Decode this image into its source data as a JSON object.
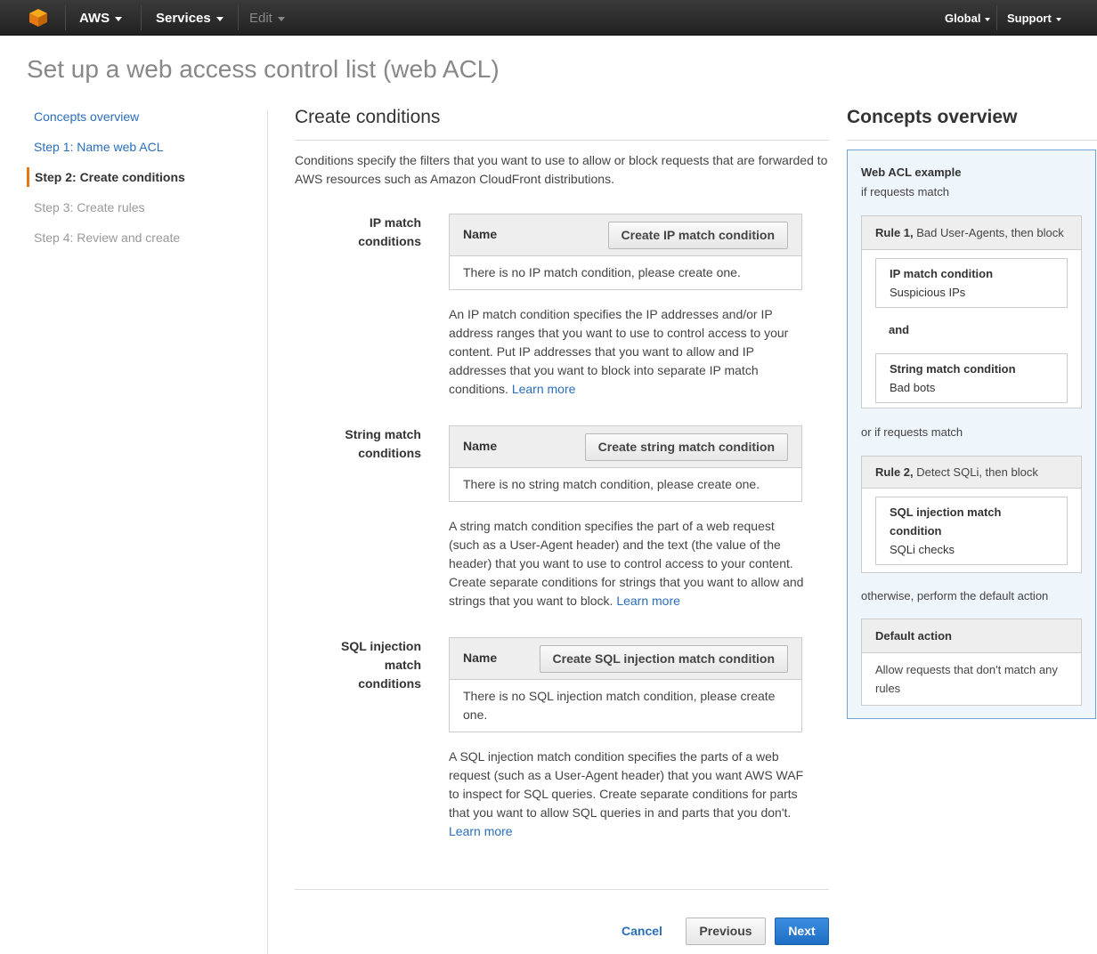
{
  "nav": {
    "brand": "AWS",
    "services": "Services",
    "edit": "Edit",
    "region": "Global",
    "support": "Support"
  },
  "page_title": "Set up a web access control list (web ACL)",
  "steps": [
    {
      "label": "Concepts overview"
    },
    {
      "label": "Step 1: Name web ACL"
    },
    {
      "label": "Step 2: Create conditions"
    },
    {
      "label": "Step 3: Create rules"
    },
    {
      "label": "Step 4: Review and create"
    }
  ],
  "main": {
    "heading": "Create conditions",
    "intro": "Conditions specify the filters that you want to use to allow or block requests that are forwarded to AWS resources such as Amazon CloudFront distributions.",
    "conditions": [
      {
        "label_l1": "IP match",
        "label_l2": "conditions",
        "column": "Name",
        "button": "Create IP match condition",
        "empty": "There is no IP match condition, please create one.",
        "desc": "An IP match condition specifies the IP addresses and/or IP address ranges that you want to use to control access to your content. Put IP addresses that you want to allow and IP addresses that you want to block into separate IP match conditions.",
        "learn": "Learn more"
      },
      {
        "label_l1": "String match",
        "label_l2": "conditions",
        "column": "Name",
        "button": "Create string match condition",
        "empty": "There is no string match condition, please create one.",
        "desc": "A string match condition specifies the part of a web request (such as a User-Agent header) and the text (the value of the header) that you want to use to control access to your content. Create separate conditions for strings that you want to allow and strings that you want to block.",
        "learn": "Learn more"
      },
      {
        "label_l1": "SQL injection",
        "label_l2": "match",
        "label_l3": "conditions",
        "column": "Name",
        "button": "Create SQL injection match condition",
        "empty": "There is no SQL injection match condition, please create one.",
        "desc": "A SQL injection match condition specifies the parts of a web request (such as a User-Agent header) that you want AWS WAF to inspect for SQL queries. Create separate conditions for parts that you want to allow SQL queries in and parts that you don't.",
        "learn": "Learn more"
      }
    ],
    "cancel": "Cancel",
    "previous": "Previous",
    "next": "Next"
  },
  "concepts": {
    "heading": "Concepts overview",
    "example_title": "Web ACL example",
    "if_match": "if requests match",
    "rule1_bold": "Rule 1,",
    "rule1_rest": "Bad User-Agents, then block",
    "ip_title": "IP match condition",
    "ip_value": "Suspicious IPs",
    "and": "and",
    "string_title": "String match condition",
    "string_value": "Bad bots",
    "or_if": "or if requests match",
    "rule2_bold": "Rule 2,",
    "rule2_rest": "Detect SQLi, then block",
    "sql_title": "SQL injection match condition",
    "sql_value": "SQLi checks",
    "otherwise": "otherwise, perform the default action",
    "default_title": "Default action",
    "default_text": "Allow requests that don't match any rules"
  },
  "colors": {
    "accent": "#e47911",
    "link": "#2a6ebb",
    "primary_button": "#1f6fc5",
    "panel_bg": "#eef5fb",
    "panel_border": "#6da4d4"
  }
}
